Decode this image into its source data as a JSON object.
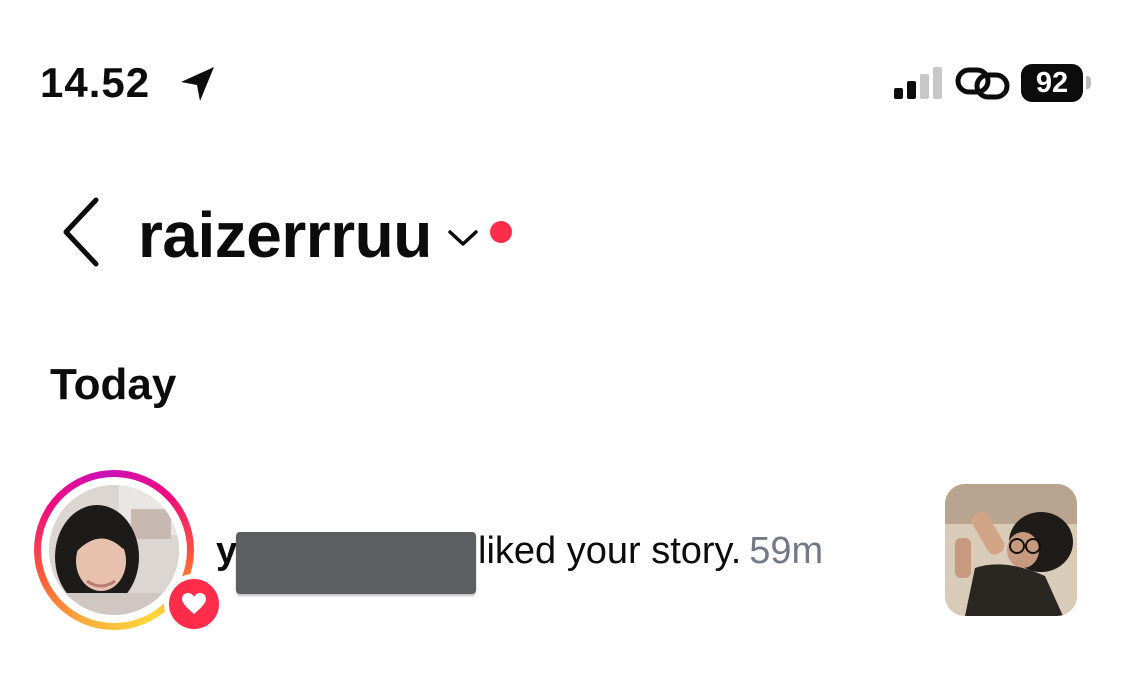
{
  "status_bar": {
    "time": "14.52",
    "battery_level": "92",
    "icons": [
      "location-arrow-icon",
      "signal-bars-icon",
      "hotspot-link-icon",
      "battery-icon"
    ]
  },
  "header": {
    "account_name": "raizerrruu",
    "icons": [
      "back-chevron-icon",
      "chevron-down-icon",
      "unread-dot"
    ]
  },
  "section": {
    "title": "Today"
  },
  "notification": {
    "username_visible": "y",
    "message": "liked your story.",
    "time": "59m",
    "badge_icon": "heart-icon",
    "username_redacted": true
  },
  "colors": {
    "text": "#0c0c0c",
    "muted": "#737a86",
    "red_accent": "#ff2d49",
    "redaction": "#5d5e61"
  }
}
